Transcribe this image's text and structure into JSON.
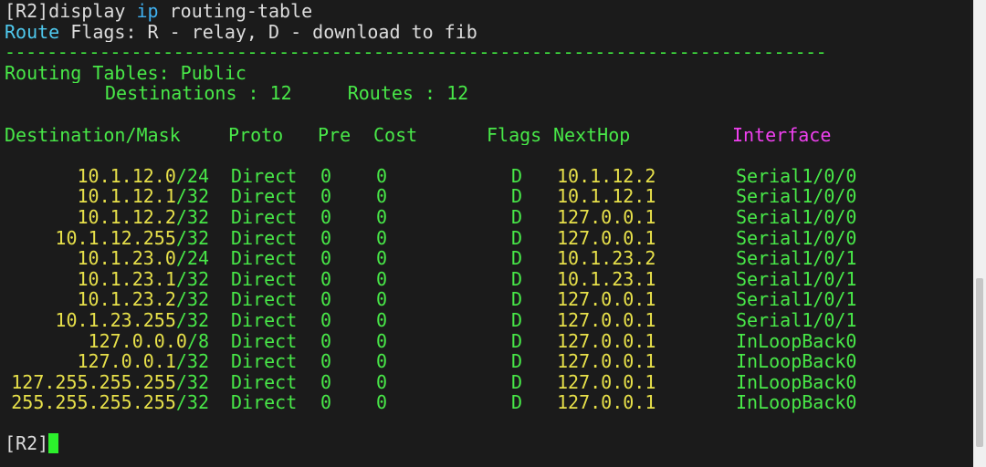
{
  "command": {
    "prompt": "[R2]",
    "verb": "display ",
    "keyword": "ip",
    "args": " routing-table"
  },
  "flags_legend": {
    "label": "Route",
    "text": " Flags: R - relay, D - download to fib"
  },
  "separator": "------------------------------------------------------------------------------",
  "routing_tables": {
    "title": "Routing Tables: Public",
    "destinations_label": "Destinations : ",
    "destinations_value": "12",
    "routes_label": "Routes : ",
    "routes_value": "12"
  },
  "table": {
    "headers": {
      "destination": "Destination/Mask",
      "proto": "Proto",
      "pre": "Pre",
      "cost": "Cost",
      "flags": "Flags",
      "nexthop": "NextHop",
      "interface": "Interface"
    },
    "rows": [
      {
        "dest": "10.1.12.0",
        "mask": "/24",
        "proto": "Direct",
        "pre": "0",
        "cost": "0",
        "flags": "D",
        "nexthop": "10.1.12.2",
        "iface": "Serial1/0/0"
      },
      {
        "dest": "10.1.12.1",
        "mask": "/32",
        "proto": "Direct",
        "pre": "0",
        "cost": "0",
        "flags": "D",
        "nexthop": "10.1.12.1",
        "iface": "Serial1/0/0"
      },
      {
        "dest": "10.1.12.2",
        "mask": "/32",
        "proto": "Direct",
        "pre": "0",
        "cost": "0",
        "flags": "D",
        "nexthop": "127.0.0.1",
        "iface": "Serial1/0/0"
      },
      {
        "dest": "10.1.12.255",
        "mask": "/32",
        "proto": "Direct",
        "pre": "0",
        "cost": "0",
        "flags": "D",
        "nexthop": "127.0.0.1",
        "iface": "Serial1/0/0"
      },
      {
        "dest": "10.1.23.0",
        "mask": "/24",
        "proto": "Direct",
        "pre": "0",
        "cost": "0",
        "flags": "D",
        "nexthop": "10.1.23.2",
        "iface": "Serial1/0/1"
      },
      {
        "dest": "10.1.23.1",
        "mask": "/32",
        "proto": "Direct",
        "pre": "0",
        "cost": "0",
        "flags": "D",
        "nexthop": "10.1.23.1",
        "iface": "Serial1/0/1"
      },
      {
        "dest": "10.1.23.2",
        "mask": "/32",
        "proto": "Direct",
        "pre": "0",
        "cost": "0",
        "flags": "D",
        "nexthop": "127.0.0.1",
        "iface": "Serial1/0/1"
      },
      {
        "dest": "10.1.23.255",
        "mask": "/32",
        "proto": "Direct",
        "pre": "0",
        "cost": "0",
        "flags": "D",
        "nexthop": "127.0.0.1",
        "iface": "Serial1/0/1"
      },
      {
        "dest": "127.0.0.0",
        "mask": "/8",
        "proto": "Direct",
        "pre": "0",
        "cost": "0",
        "flags": "D",
        "nexthop": "127.0.0.1",
        "iface": "InLoopBack0"
      },
      {
        "dest": "127.0.0.1",
        "mask": "/32",
        "proto": "Direct",
        "pre": "0",
        "cost": "0",
        "flags": "D",
        "nexthop": "127.0.0.1",
        "iface": "InLoopBack0"
      },
      {
        "dest": "127.255.255.255",
        "mask": "/32",
        "proto": "Direct",
        "pre": "0",
        "cost": "0",
        "flags": "D",
        "nexthop": "127.0.0.1",
        "iface": "InLoopBack0"
      },
      {
        "dest": "255.255.255.255",
        "mask": "/32",
        "proto": "Direct",
        "pre": "0",
        "cost": "0",
        "flags": "D",
        "nexthop": "127.0.0.1",
        "iface": "InLoopBack0"
      }
    ]
  },
  "final_prompt": "[R2]",
  "colors": {
    "background": "#1b1b1b",
    "ip_green": "#48e848",
    "ip_yellow": "#e7e04a",
    "interface_header": "#f040f0",
    "route_label": "#4fc9ee"
  }
}
